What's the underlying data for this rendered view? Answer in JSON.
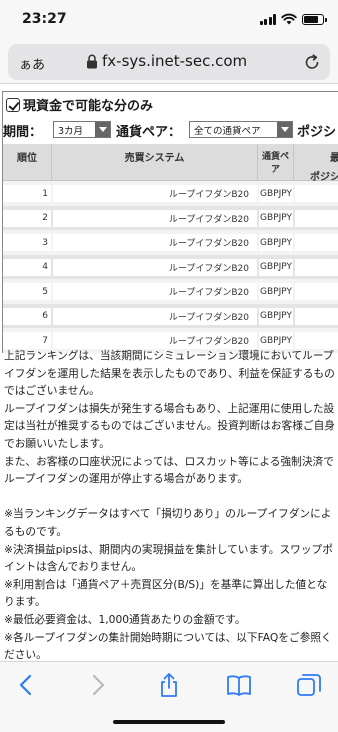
{
  "status_bar": {
    "time": "23:27",
    "battery_level": 0.75
  },
  "browser": {
    "aa_label": "ぁあ",
    "url": "fx-sys.inet-sec.com"
  },
  "filter": {
    "checkbox_label": "現資金で可能な分のみ",
    "checked": true,
    "period_label": "期間：",
    "period_value": "3カ月",
    "pair_label": "通貨ペア：",
    "pair_value": "全ての通貨ペア",
    "position_label": "ポジショ"
  },
  "table": {
    "headers": {
      "rank": "順位",
      "system": "売買システム",
      "pair": "通貨ペア",
      "extra_line1": "最大",
      "extra_line2": "ポジショ"
    },
    "rows": [
      {
        "rank": "1",
        "system": "ループイフダンB20",
        "pair": "GBPJPY"
      },
      {
        "rank": "2",
        "system": "ループイフダンB20",
        "pair": "GBPJPY"
      },
      {
        "rank": "3",
        "system": "ループイフダンB20",
        "pair": "GBPJPY"
      },
      {
        "rank": "4",
        "system": "ループイフダンB20",
        "pair": "GBPJPY"
      },
      {
        "rank": "5",
        "system": "ループイフダンB20",
        "pair": "GBPJPY"
      },
      {
        "rank": "6",
        "system": "ループイフダンB20",
        "pair": "GBPJPY"
      },
      {
        "rank": "7",
        "system": "ループイフダンB20",
        "pair": "GBPJPY"
      }
    ]
  },
  "description": {
    "p1": "上記ランキングは、当該期間にシミュレーション環境においてループイフダンを運用した結果を表示したものであり、利益を保証するものではございません。",
    "p2": "ループイフダンは損失が発生する場合もあり、上記運用に使用した設定は当社が推奨するものではございません。投資判断はお客様ご自身でお願いいたします。",
    "p3": "また、お客様の口座状況によっては、ロスカット等による強制決済でループイフダンの運用が停止する場合があります。",
    "n1": "※当ランキングデータはすべて「損切りあり」のループイフダンによるものです。",
    "n2": "※決済損益pipsは、期間内の実現損益を集計しています。スワップポイントは含んでおりません。",
    "n3": "※利用割合は「通貨ペア＋売買区分(B/S)」を基準に算出した値となります。",
    "n4": "※最低必要資金は、1,000通貨あたりの金額です。",
    "n5": "※各ループイフダンの集計開始時期については、以下FAQをご参照ください。"
  },
  "toolbar": {
    "back_icon": "chevron-left-icon",
    "forward_icon": "chevron-right-icon",
    "share_icon": "share-icon",
    "bookmarks_icon": "book-icon",
    "tabs_icon": "tabs-icon"
  },
  "colors": {
    "accent": "#2f7bf5",
    "disabled": "#b8b8bd"
  }
}
